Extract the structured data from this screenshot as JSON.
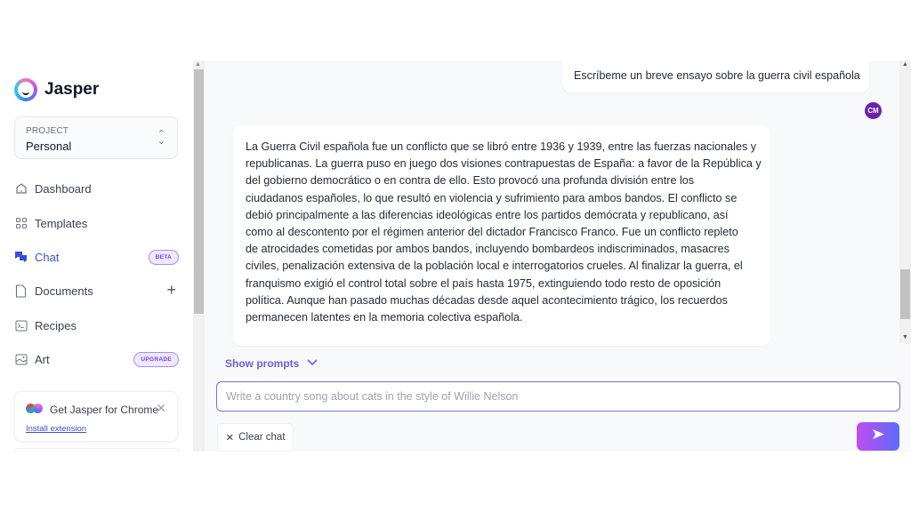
{
  "app": {
    "name": "Jasper"
  },
  "project": {
    "label": "PROJECT",
    "value": "Personal"
  },
  "sidebar": {
    "items": [
      {
        "label": "Dashboard",
        "icon": "home-icon"
      },
      {
        "label": "Templates",
        "icon": "grid-icon"
      },
      {
        "label": "Chat",
        "icon": "chat-icon",
        "badge": "BETA",
        "active": true
      },
      {
        "label": "Documents",
        "icon": "document-icon",
        "action": "+"
      },
      {
        "label": "Recipes",
        "icon": "terminal-icon"
      },
      {
        "label": "Art",
        "icon": "image-icon",
        "badge": "UPGRADE"
      }
    ],
    "chrome_card": {
      "title": "Get Jasper for Chrome",
      "link": "Install extension",
      "close": "✕"
    }
  },
  "chat": {
    "messages": [
      {
        "role": "user",
        "text": "Escríbeme un breve ensayo sobre la guerra civil española",
        "avatar_initials": "CM"
      },
      {
        "role": "assistant",
        "text": "La Guerra Civil española fue un conflicto que se libró entre 1936 y 1939, entre las fuerzas nacionales y\nrepublicanas. La guerra puso en juego dos visiones contrapuestas de España: a favor de la República y\ndel gobierno democrático o en contra de ello. Esto provocó una profunda división entre los\nciudadanos españoles, lo que resultó en violencia y sufrimiento para ambos bandos. El conflicto se\ndebió principalmente a las diferencias ideológicas entre los partidos demócrata y republicano, así\ncomo al descontento por el régimen anterior del dictador Francisco Franco. Fue un conflicto repleto\nde atrocidades cometidas por ambos bandos, incluyendo bombardeos indiscriminados, masacres\nciviles, penalización extensiva de la población local e interrogatorios crueles. Al finalizar la guerra, el\nfranquismo exigió el control total sobre el país hasta 1975, extinguiendo todo resto de oposición\npolítica. Aunque han pasado muchas décadas desde aquel acontecimiento trágico, los recuerdos\npermanecen latentes en la memoria colectiva española."
      }
    ],
    "show_prompts_label": "Show prompts",
    "input": {
      "value": "",
      "placeholder": "Write a country song about cats in the style of Willie Nelson"
    },
    "clear_label": "Clear chat",
    "clear_icon": "✕"
  },
  "colors": {
    "accent": "#3b4fd9",
    "badge": "#7c3aed",
    "avatar": "#6b21a8",
    "input_border": "#7c6be6"
  }
}
